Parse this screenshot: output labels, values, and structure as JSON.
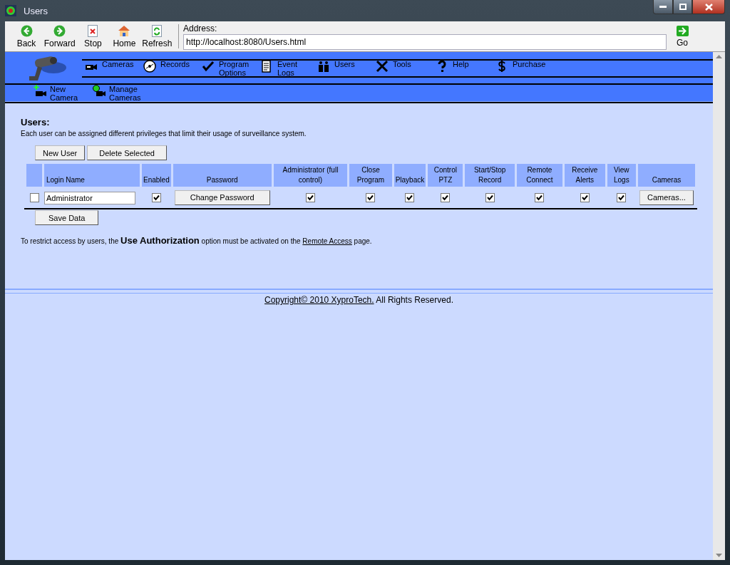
{
  "window": {
    "title": "Users"
  },
  "toolbar": {
    "buttons": [
      {
        "label": "Back",
        "kind": "back"
      },
      {
        "label": "Forward",
        "kind": "forward"
      },
      {
        "label": "Stop",
        "kind": "stop"
      },
      {
        "label": "Home",
        "kind": "home"
      },
      {
        "label": "Refresh",
        "kind": "refresh"
      }
    ],
    "address_label": "Address:",
    "address": "http://localhost:8080/Users.html",
    "go": "Go"
  },
  "menu": [
    {
      "label": "Cameras",
      "kind": "camera"
    },
    {
      "label": "Records",
      "kind": "disc"
    },
    {
      "label": "Program Options",
      "kind": "check"
    },
    {
      "label": "Event Logs",
      "kind": "doc"
    },
    {
      "label": "Users",
      "kind": "users"
    },
    {
      "label": "Tools",
      "kind": "tools"
    },
    {
      "label": "Help",
      "kind": "help"
    },
    {
      "label": "Purchase",
      "kind": "dollar"
    }
  ],
  "submenu": [
    {
      "label": "New Camera",
      "kind": "add"
    },
    {
      "label": "Manage Cameras",
      "kind": "manage"
    }
  ],
  "heading": "Users:",
  "description": "Each user can be assigned different privileges that limit their usage of surveillance system.",
  "actions": [
    "New User",
    "Delete Selected"
  ],
  "table": {
    "columns": [
      {
        "kind": "select"
      },
      {
        "label": "Login Name"
      },
      {
        "label": "Enabled"
      },
      {
        "label": "Password"
      },
      {
        "label": "Administrator (full control)"
      },
      {
        "label": "Close Program"
      },
      {
        "label": "Playback"
      },
      {
        "label": "Control PTZ"
      },
      {
        "label": "Start/Stop Record"
      },
      {
        "label": "Remote Connect"
      },
      {
        "label": "Receive Alerts"
      },
      {
        "label": "View Logs"
      },
      {
        "label": "Cameras"
      }
    ],
    "rows": [
      {
        "cells": [
          {
            "kind": "check",
            "checked": false
          },
          {
            "kind": "input",
            "value": "Administrator"
          },
          {
            "kind": "check",
            "checked": true
          },
          {
            "kind": "button",
            "label": "Change Password"
          },
          {
            "kind": "check",
            "checked": true
          },
          {
            "kind": "check",
            "checked": true
          },
          {
            "kind": "check",
            "checked": true
          },
          {
            "kind": "check",
            "checked": true
          },
          {
            "kind": "check",
            "checked": true
          },
          {
            "kind": "check",
            "checked": true
          },
          {
            "kind": "check",
            "checked": true
          },
          {
            "kind": "check",
            "checked": true
          },
          {
            "kind": "button",
            "label": "Cameras..."
          }
        ]
      }
    ]
  },
  "save": "Save Data",
  "note": {
    "before": "To restrict access by users, the ",
    "emphasis": "Use Authorization",
    "middle": " option must be activated on the ",
    "link": "Remote Access",
    "after": " page."
  },
  "footer": {
    "link": "Copyright© 2010 XyproTech.",
    "text": " All Rights Reserved."
  }
}
